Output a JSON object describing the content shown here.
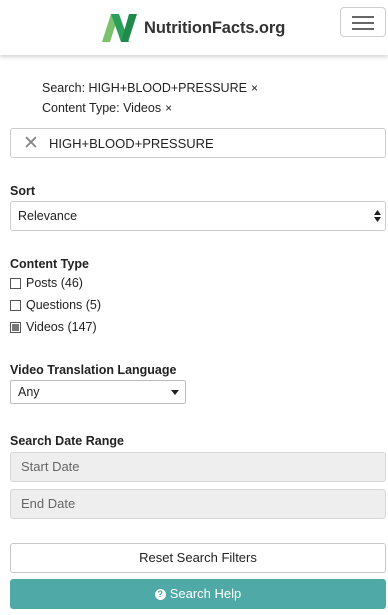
{
  "header": {
    "logo_text": "NutritionFacts.org",
    "menu_icon": "hamburger-icon"
  },
  "active_filters": [
    {
      "text": "Search: HIGH+BLOOD+PRESSURE",
      "remove": "×"
    },
    {
      "text": "Content Type: Videos",
      "remove": "×"
    }
  ],
  "search": {
    "value": "HIGH+BLOOD+PRESSURE",
    "clear_icon": "close-icon"
  },
  "sort": {
    "label": "Sort",
    "selected": "Relevance"
  },
  "content_type": {
    "label": "Content Type",
    "options": [
      {
        "label": "Posts (46)",
        "checked": false
      },
      {
        "label": "Questions (5)",
        "checked": false
      },
      {
        "label": "Videos (147)",
        "checked": true
      }
    ]
  },
  "translation": {
    "label": "Video Translation Language",
    "selected": "Any"
  },
  "date_range": {
    "label": "Search Date Range",
    "start_placeholder": "Start Date",
    "end_placeholder": "End Date"
  },
  "buttons": {
    "reset": "Reset Search Filters",
    "help": "Search Help",
    "help_icon": "question-circle-icon"
  },
  "colors": {
    "accent": "#4fa9a6",
    "logo_green": "#2e9f5b"
  }
}
